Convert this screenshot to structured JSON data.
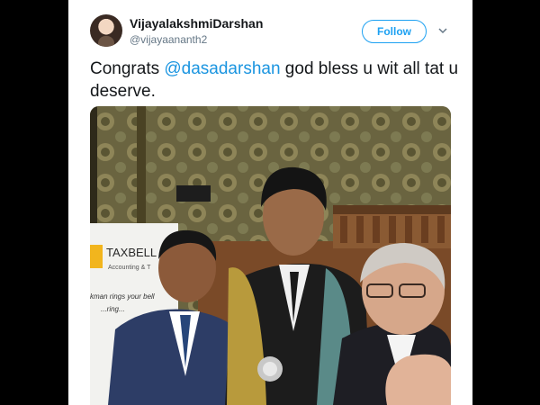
{
  "tweet": {
    "author_name": "VijayalakshmiDarshan",
    "author_handle": "@vijayaananth2",
    "follow_label": "Follow",
    "text_prefix": "Congrats ",
    "mention": "@dasadarshan",
    "text_suffix": " god bless u wit all tat u deserve."
  },
  "photo": {
    "banner_brand": "TAXBELL",
    "banner_tagline": "Accounting & T",
    "banner_line1": "kman rings your bell",
    "banner_line2": "...ring..."
  },
  "colors": {
    "accent": "#1da1f2",
    "mention": "#1b95e0",
    "text": "#14171a",
    "muted": "#657786"
  },
  "icons": [
    "avatar",
    "chevron-down-icon"
  ]
}
